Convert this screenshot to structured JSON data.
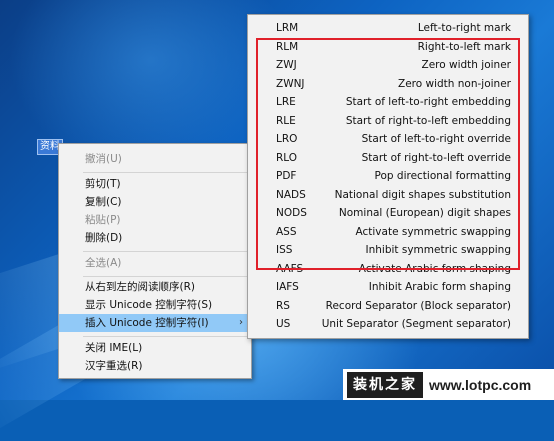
{
  "selected_text": "资料",
  "context_menu": {
    "items": [
      {
        "label": "撤消(U)",
        "disabled": true
      },
      {
        "label": "剪切(T)",
        "disabled": false
      },
      {
        "label": "复制(C)",
        "disabled": false
      },
      {
        "label": "粘贴(P)",
        "disabled": true
      },
      {
        "label": "删除(D)",
        "disabled": false
      },
      {
        "label": "全选(A)",
        "disabled": true
      },
      {
        "label": "从右到左的阅读顺序(R)",
        "disabled": false
      },
      {
        "label": "显示 Unicode 控制字符(S)",
        "disabled": false
      },
      {
        "label": "插入 Unicode 控制字符(I)",
        "disabled": false,
        "submenu_arrow": "›"
      },
      {
        "label": "关闭 IME(L)",
        "disabled": false
      },
      {
        "label": "汉字重选(R)",
        "disabled": false
      }
    ]
  },
  "submenu": {
    "rows": [
      {
        "abbr": "LRM",
        "desc": "Left-to-right mark"
      },
      {
        "abbr": "RLM",
        "desc": "Right-to-left mark"
      },
      {
        "abbr": "ZWJ",
        "desc": "Zero width joiner"
      },
      {
        "abbr": "ZWNJ",
        "desc": "Zero width non-joiner"
      },
      {
        "abbr": "LRE",
        "desc": "Start of left-to-right embedding"
      },
      {
        "abbr": "RLE",
        "desc": "Start of right-to-left embedding"
      },
      {
        "abbr": "LRO",
        "desc": "Start of left-to-right override"
      },
      {
        "abbr": "RLO",
        "desc": "Start of right-to-left override"
      },
      {
        "abbr": "PDF",
        "desc": "Pop directional formatting"
      },
      {
        "abbr": "NADS",
        "desc": "National digit shapes substitution"
      },
      {
        "abbr": "NODS",
        "desc": "Nominal (European) digit shapes"
      },
      {
        "abbr": "ASS",
        "desc": "Activate symmetric swapping"
      },
      {
        "abbr": "ISS",
        "desc": "Inhibit symmetric swapping"
      },
      {
        "abbr": "AAFS",
        "desc": "Activate Arabic form shaping"
      },
      {
        "abbr": "IAFS",
        "desc": "Inhibit Arabic form shaping"
      },
      {
        "abbr": "RS",
        "desc": "Record Separator (Block separator)"
      },
      {
        "abbr": "US",
        "desc": "Unit Separator (Segment separator)"
      }
    ]
  },
  "colors": {
    "highlight_box": "#e0202a",
    "menu_hover": "#91c9f7",
    "menu_bg": "#f2f2f2"
  },
  "watermark": {
    "brand": "装机之家",
    "url": "www.lotpc.com"
  }
}
